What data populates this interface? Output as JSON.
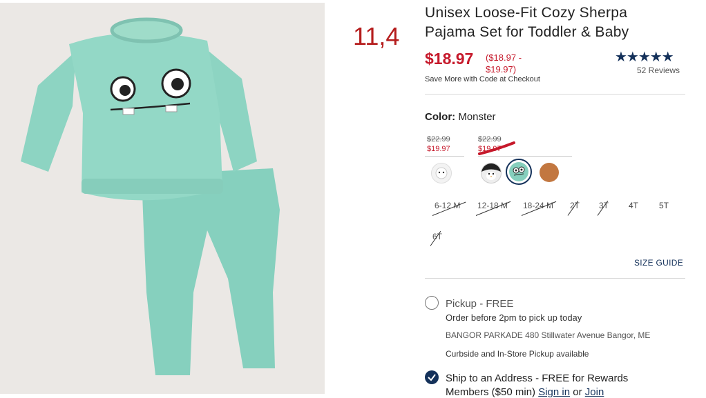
{
  "annotation": "11,4",
  "product": {
    "title": "Unisex Loose-Fit Cozy Sherpa Pajama Set for Toddler & Baby",
    "price": "$18.97",
    "price_range": "($18.97 - $19.97)",
    "promo": "Save More with Code at Checkout",
    "rating_stars": "★★★★★",
    "reviews": "52 Reviews"
  },
  "color": {
    "label": "Color:",
    "value": "Monster",
    "groups": [
      {
        "old": "$22.99",
        "new": "$19.97"
      },
      {
        "old": "$22.99",
        "new": "$19.97"
      }
    ],
    "swatches": [
      "polar-bear",
      "penguin",
      "monster",
      "brown-sherpa"
    ],
    "selected": "monster"
  },
  "sizes": [
    {
      "label": "6-12 M",
      "available": false
    },
    {
      "label": "12-18 M",
      "available": false
    },
    {
      "label": "18-24 M",
      "available": false
    },
    {
      "label": "2T",
      "available": false
    },
    {
      "label": "3T",
      "available": false
    },
    {
      "label": "4T",
      "available": true
    },
    {
      "label": "5T",
      "available": true
    },
    {
      "label": "6T",
      "available": false
    }
  ],
  "size_guide": "SIZE GUIDE",
  "fulfillment": {
    "pickup_label": "Pickup - FREE",
    "pickup_note": "Order before 2pm to pick up today",
    "store": "BANGOR PARKADE",
    "store_address": "480 Stillwater Avenue  Bangor, ME",
    "curbside": "Curbside and In-Store Pickup available",
    "ship_label": "Ship to an Address - FREE for Rewards",
    "ship_line2": "Members ($50 min)",
    "signin": "Sign in",
    "or": "or",
    "join": "Join"
  },
  "colors": {
    "sale": "#c6192b",
    "navy": "#14315a",
    "annotation": "#b51d1d"
  }
}
